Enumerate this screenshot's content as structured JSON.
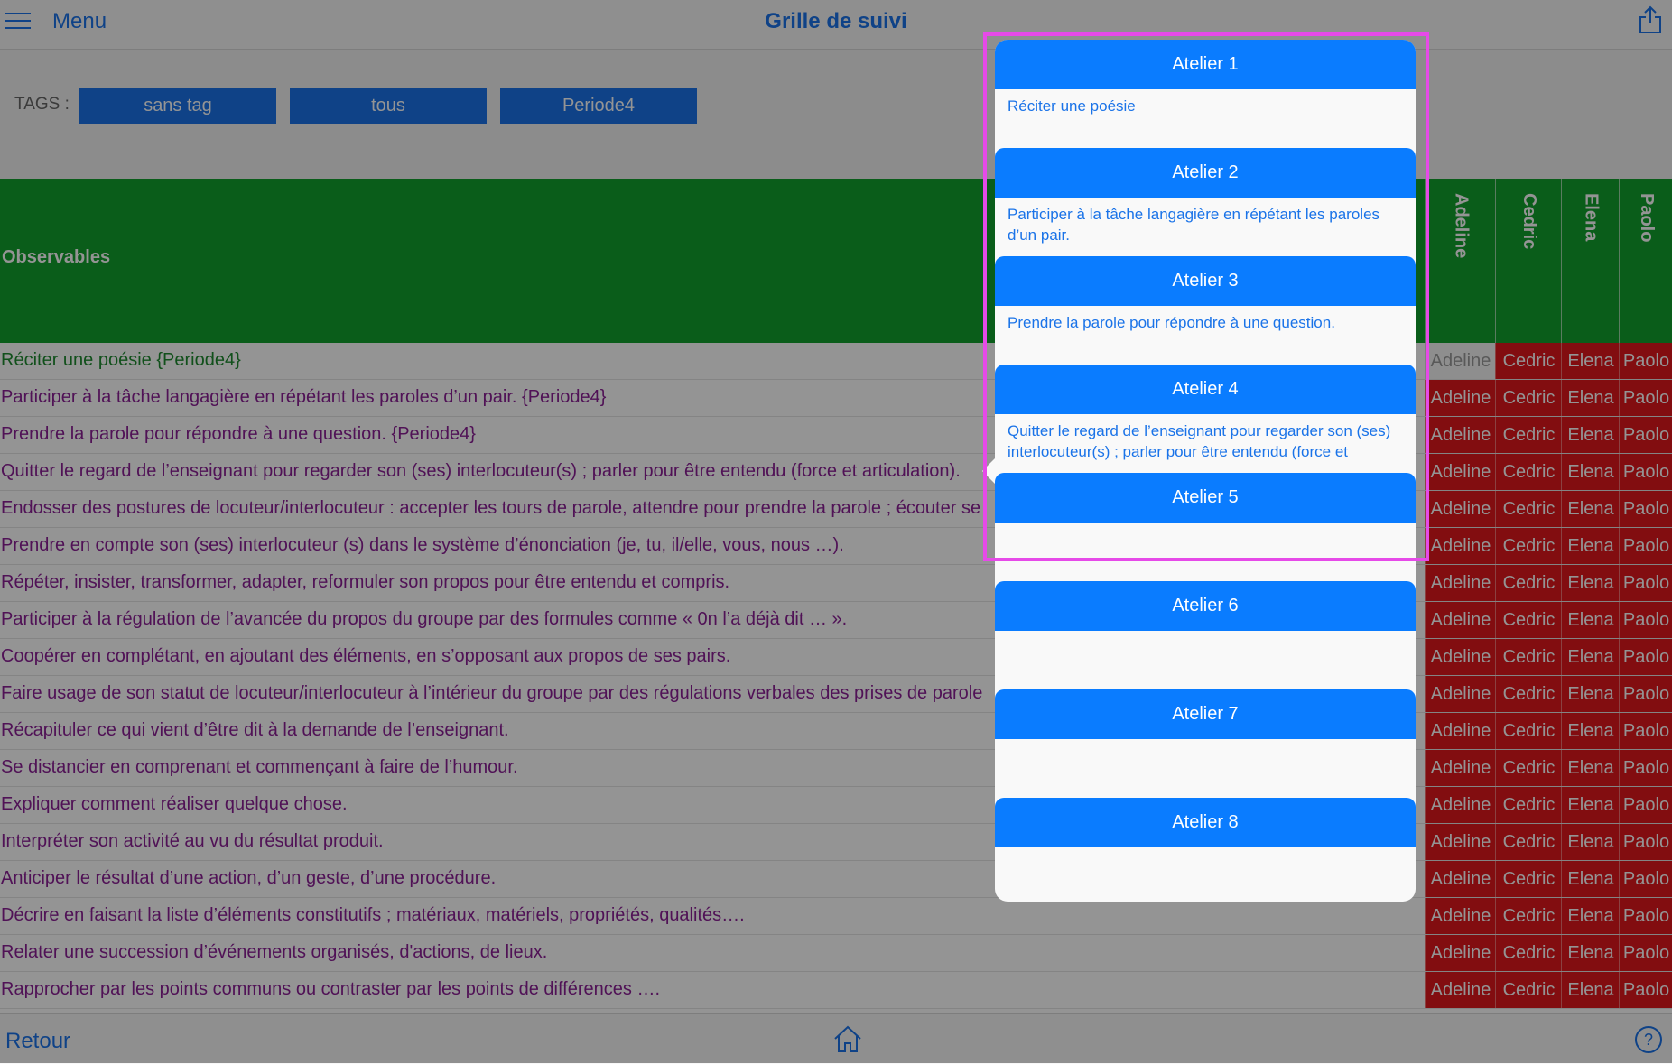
{
  "header": {
    "menu_label": "Menu",
    "title": "Grille de suivi"
  },
  "tags": {
    "label": "TAGS :",
    "buttons": [
      "sans tag",
      "tous",
      "Periode4"
    ]
  },
  "grid": {
    "observables_label": "Observables",
    "students": [
      "Adeline",
      "Cedric",
      "Elena",
      "Paolo"
    ],
    "rows": [
      "Réciter une poésie {Periode4}",
      "Participer à la tâche langagière en répétant les paroles d’un pair. {Periode4}",
      "Prendre la parole pour répondre à une question. {Periode4}",
      "Quitter le regard de l’enseignant pour regarder son (ses) interlocuteur(s) ; parler pour être entendu (force et articulation).",
      "Endosser des postures de locuteur/interlocuteur : accepter les tours de parole, attendre pour prendre la parole ; écouter se",
      "Prendre en compte son (ses) interlocuteur (s) dans le système d’énonciation (je, tu, il/elle, vous, nous …).",
      "Répéter, insister, transformer, adapter, reformuler son propos pour être entendu et compris.",
      "Participer à la régulation de l’avancée du propos du groupe par des formules comme « 0n l’a déjà dit … ».",
      "Coopérer en complétant, en ajoutant des éléments, en s’opposant aux propos de ses pairs.",
      "Faire usage de son statut de locuteur/interlocuteur à l’intérieur du groupe par des régulations verbales des prises de parole",
      "Récapituler ce qui vient d’être dit à la demande de l’enseignant.",
      "Se distancier en comprenant et commençant à faire de l’humour.",
      "Expliquer comment réaliser quelque chose.",
      "Interpréter son activité au vu du résultat produit.",
      "Anticiper le résultat d’une action, d’un geste, d’une procédure.",
      "Décrire en faisant la liste d’éléments constitutifs ; matériaux, matériels, propriétés, qualités….",
      "Relater une succession d’événements organisés, d'actions, de lieux.",
      "Rapprocher par les points communs ou contraster par les points de différences …."
    ]
  },
  "popover": {
    "ateliers": [
      {
        "title": "Atelier 1",
        "desc": "Réciter une poésie"
      },
      {
        "title": "Atelier 2",
        "desc": "Participer à la tâche langagière en répétant les paroles d’un pair."
      },
      {
        "title": "Atelier 3",
        "desc": "Prendre la parole pour répondre à une question."
      },
      {
        "title": "Atelier 4",
        "desc": "Quitter le regard de l’enseignant pour regarder son (ses) interlocuteur(s) ; parler pour être entendu (force et articulation)"
      },
      {
        "title": "Atelier 5",
        "desc": ""
      },
      {
        "title": "Atelier 6",
        "desc": ""
      },
      {
        "title": "Atelier 7",
        "desc": ""
      },
      {
        "title": "Atelier 8",
        "desc": ""
      }
    ]
  },
  "footer": {
    "back_label": "Retour"
  },
  "colors": {
    "accent": "#1a73e8",
    "header_green": "#12a12d",
    "cell_red": "#e0181c",
    "atelier_blue": "#0a7cff",
    "highlight": "#e64ae8"
  },
  "icons": {
    "menu": "hamburger-icon",
    "share": "share-icon",
    "home": "home-icon",
    "help": "help-icon"
  }
}
